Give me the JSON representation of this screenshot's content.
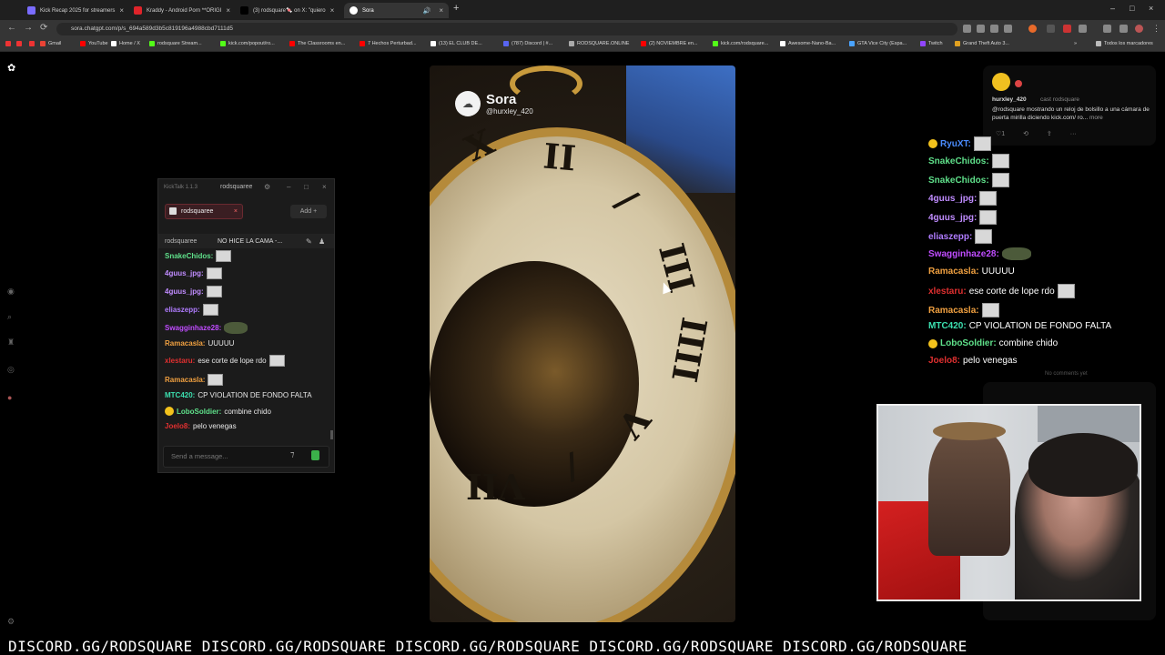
{
  "tabs": [
    {
      "label": "Kick Recap 2025 for streamers",
      "fav": "#7a6cff"
    },
    {
      "label": "Kraddy - Android Porn **ORIGI",
      "fav": "#e0242a"
    },
    {
      "label": "(3) rodsquare🍬 on X: \"quiero",
      "fav": "#000000"
    },
    {
      "label": "Sora",
      "fav": "#ffffff"
    }
  ],
  "url": "sora.chatgpt.com/p/s_694a589d3b5c819196a4988cbd7111d5",
  "bookmarks": [
    {
      "label": "Gmail",
      "c": "#ea4335"
    },
    {
      "label": "YouTube",
      "c": "#ff0000"
    },
    {
      "label": "Home / X",
      "c": "#ffffff"
    },
    {
      "label": "rodsquare Stream...",
      "c": "#53fc18"
    },
    {
      "label": "kick.com/popout/ro...",
      "c": "#53fc18"
    },
    {
      "label": "The Classrooms en...",
      "c": "#ff0000"
    },
    {
      "label": "7 Hechos Perturbad...",
      "c": "#ff0000"
    },
    {
      "label": "(13) EL CLUB DE...",
      "c": "#ffffff"
    },
    {
      "label": "(787) Discord | #...",
      "c": "#5865f2"
    },
    {
      "label": "RODSQUARE.ONLINE",
      "c": "#aaaaaa"
    },
    {
      "label": "(2) NOVIEMBRE en...",
      "c": "#ff0000"
    },
    {
      "label": "kick.com/rodsquare...",
      "c": "#53fc18"
    },
    {
      "label": "Awesome-Nano-Ba...",
      "c": "#ffffff"
    },
    {
      "label": "GTA Vice City (Espa...",
      "c": "#4aa3ff"
    },
    {
      "label": "Twitch",
      "c": "#9146ff"
    },
    {
      "label": "Grand Theft Auto 3...",
      "c": "#e0a020"
    }
  ],
  "bookmarks_all": "Todos los marcadores",
  "sora": {
    "name": "Sora",
    "handle": "@hurxley_420"
  },
  "kicktalk": {
    "title": "KickTalk 1.1.3",
    "user": "rodsquaree",
    "chip": "rodsquaree",
    "add": "Add",
    "head_user": "rodsquaree",
    "head_title": "NO HICE LA CAMA -...",
    "input_placeholder": "Send a message...",
    "messages": [
      {
        "user": "SnakeChidos:",
        "color": "#5fe08a",
        "text": "",
        "emote": "box"
      },
      {
        "user": "4guus_jpg:",
        "color": "#c08cff",
        "text": "",
        "emote": "box"
      },
      {
        "user": "4guus_jpg:",
        "color": "#c08cff",
        "text": "",
        "emote": "box"
      },
      {
        "user": "eliaszepp:",
        "color": "#b07cff",
        "text": "",
        "emote": "box"
      },
      {
        "user": "Swagginhaze28:",
        "color": "#c04cff",
        "text": "",
        "emote": "green"
      },
      {
        "user": "Ramacasla:",
        "color": "#f0a040",
        "text": "UUUUU",
        "emote": ""
      },
      {
        "user": "xlestaru:",
        "color": "#e03030",
        "text": "ese corte de lope rdo",
        "emote": "box"
      },
      {
        "user": "Ramacasla:",
        "color": "#f0a040",
        "text": "",
        "emote": "box"
      },
      {
        "user": "MTC420:",
        "color": "#3ce0b0",
        "text": "CP VIOLATION DE FONDO FALTA",
        "emote": ""
      },
      {
        "user": "LoboSoldier:",
        "color": "#5fe08a",
        "text": "combine chido",
        "emote": "",
        "smile": true
      },
      {
        "user": "Joelo8:",
        "color": "#e03030",
        "text": "pelo venegas",
        "emote": ""
      }
    ]
  },
  "right_chat": [
    {
      "user": "RyuXT:",
      "color": "#4a8cff",
      "text": "",
      "emote": "box",
      "smile": true
    },
    {
      "user": "SnakeChidos:",
      "color": "#5fe08a",
      "text": "",
      "emote": "box"
    },
    {
      "user": "SnakeChidos:",
      "color": "#5fe08a",
      "text": "",
      "emote": "box"
    },
    {
      "user": "4guus_jpg:",
      "color": "#c08cff",
      "text": "",
      "emote": "box"
    },
    {
      "user": "4guus_jpg:",
      "color": "#c08cff",
      "text": "",
      "emote": "box"
    },
    {
      "user": "eliaszepp:",
      "color": "#b07cff",
      "text": "",
      "emote": "box"
    },
    {
      "user": "Swagginhaze28:",
      "color": "#c04cff",
      "text": "",
      "emote": "green"
    },
    {
      "user": "Ramacasla:",
      "color": "#f0a040",
      "text": "UUUUU",
      "emote": ""
    },
    {
      "user": "xlestaru:",
      "color": "#e03030",
      "text": "ese corte de lope rdo",
      "emote": "box"
    },
    {
      "user": "Ramacasla:",
      "color": "#f0a040",
      "text": "",
      "emote": "box"
    },
    {
      "user": "MTC420:",
      "color": "#3ce0b0",
      "text": "CP VIOLATION DE FONDO FALTA",
      "emote": ""
    },
    {
      "user": "LoboSoldier:",
      "color": "#5fe08a",
      "text": "combine chido",
      "emote": "",
      "smile": true
    },
    {
      "user": "Joelo8:",
      "color": "#e03030",
      "text": "pelo venegas",
      "emote": ""
    }
  ],
  "comment": {
    "user": "hurxley_420",
    "cast": "cast rodsquare",
    "text": "@rodsquare mostrando un reloj de bolsillo a una cámara de puerta mirilla diciendo kick.com/ ro...",
    "more": "more",
    "actions": "♡1 ⟲ ⇪ ···",
    "no_comments": "No comments yet"
  },
  "ticker": "DISCORD.GG/RODSQUARE DISCORD.GG/RODSQUARE DISCORD.GG/RODSQUARE DISCORD.GG/RODSQUARE DISCORD.GG/RODSQUARE"
}
